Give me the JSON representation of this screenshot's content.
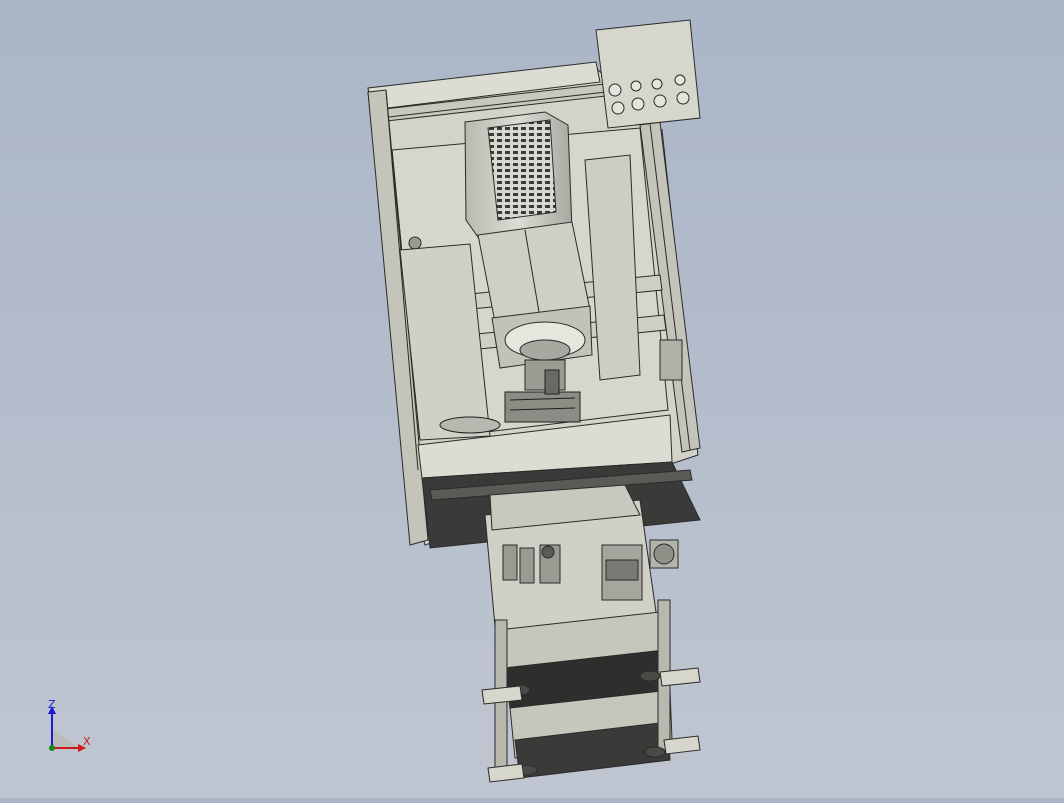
{
  "viewport": {
    "background_top": "#aab6c8",
    "background_bottom": "#c0c6d1",
    "model_color": "#d3d3c8",
    "edge_color": "#2a2a2a"
  },
  "triad": {
    "z_label": "Z",
    "x_label": "X",
    "z_color": "#1a1ad0",
    "x_color": "#d01a1a"
  }
}
